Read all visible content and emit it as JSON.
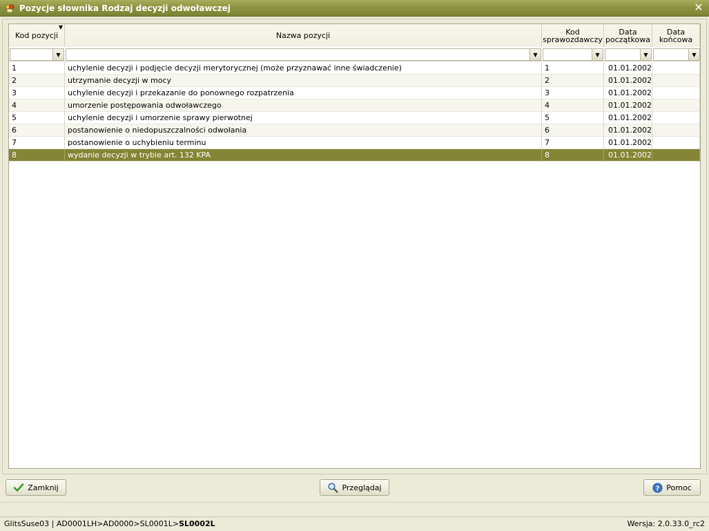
{
  "window": {
    "title": "Pozycje słownika Rodzaj decyzji odwoławczej",
    "close_symbol": "✕"
  },
  "columns": [
    {
      "line1": "Kod pozycji",
      "line2": ""
    },
    {
      "line1": "Nazwa pozycji",
      "line2": ""
    },
    {
      "line1": "Kod",
      "line2": "sprawozdawczy"
    },
    {
      "line1": "Data",
      "line2": "początkowa"
    },
    {
      "line1": "Data",
      "line2": "końcowa"
    }
  ],
  "filters": {
    "kod_pozycji": "",
    "nazwa_pozycji": "",
    "kod_sprawozdawczy": "",
    "data_poczatkowa": "",
    "data_koncowa": ""
  },
  "rows": [
    {
      "kod": "1",
      "nazwa": "uchylenie decyzji i podjęcie decyzji merytorycznej (może przyznawać inne świadczenie)",
      "kod_spr": "1",
      "data_pocz": "01.01.2002",
      "data_kon": ""
    },
    {
      "kod": "2",
      "nazwa": "utrzymanie decyzji w mocy",
      "kod_spr": "2",
      "data_pocz": "01.01.2002",
      "data_kon": ""
    },
    {
      "kod": "3",
      "nazwa": "uchylenie decyzji i przekazanie do ponownego rozpatrzenia",
      "kod_spr": "3",
      "data_pocz": "01.01.2002",
      "data_kon": ""
    },
    {
      "kod": "4",
      "nazwa": "umorzenie postępowania odwoławczego",
      "kod_spr": "4",
      "data_pocz": "01.01.2002",
      "data_kon": ""
    },
    {
      "kod": "5",
      "nazwa": "uchylenie decyzji i umorzenie sprawy pierwotnej",
      "kod_spr": "5",
      "data_pocz": "01.01.2002",
      "data_kon": ""
    },
    {
      "kod": "6",
      "nazwa": "postanowienie o niedopuszczalności odwołania",
      "kod_spr": "6",
      "data_pocz": "01.01.2002",
      "data_kon": ""
    },
    {
      "kod": "7",
      "nazwa": "postanowienie o uchybieniu terminu",
      "kod_spr": "7",
      "data_pocz": "01.01.2002",
      "data_kon": ""
    },
    {
      "kod": "8",
      "nazwa": "wydanie decyzji w trybie art. 132 KPA",
      "kod_spr": "8",
      "data_pocz": "01.01.2002",
      "data_kon": ""
    }
  ],
  "selected_row": 7,
  "buttons": {
    "close": "Zamknij",
    "browse": "Przeglądaj",
    "help": "Pomoc"
  },
  "status": {
    "path_prefix": "GlitsSuse03 | AD0001LH>AD0000>SL0001L>",
    "path_current": "SL0002L",
    "version": "Wersja: 2.0.33.0_rc2"
  },
  "colors": {
    "titlebar": "#8d9440",
    "selected_row": "#848535"
  }
}
